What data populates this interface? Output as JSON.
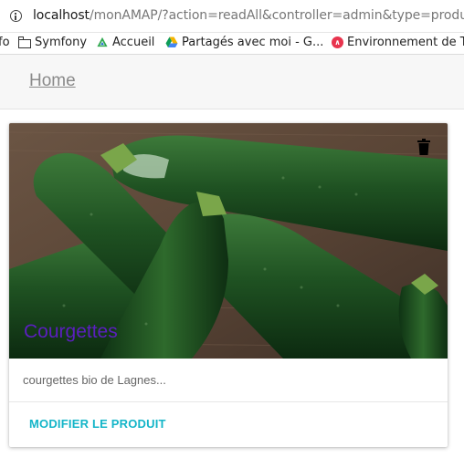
{
  "browser": {
    "url_host": "localhost",
    "url_path": "/monAMAP/?action=readAll&controller=admin&type=produit"
  },
  "bookmarks": [
    {
      "label": "fo",
      "icon": "partial-bookmark"
    },
    {
      "label": "Symfony",
      "icon": "folder-icon"
    },
    {
      "label": "Accueil",
      "icon": "accueil-icon"
    },
    {
      "label": "Partagés avec moi - G...",
      "icon": "google-drive-icon"
    },
    {
      "label": "Environnement de Tr",
      "icon": "environnement-icon"
    }
  ],
  "header": {
    "home_label": "Home"
  },
  "card": {
    "title": "Courgettes",
    "description": "courgettes bio de Lagnes...",
    "action_label": "MODIFIER LE PRODUIT",
    "image_subject": "courgettes",
    "delete_icon": "trash-icon"
  },
  "colors": {
    "title": "#5b1fbf",
    "action": "#13b5c8",
    "header_bg": "#f7f7f7"
  }
}
